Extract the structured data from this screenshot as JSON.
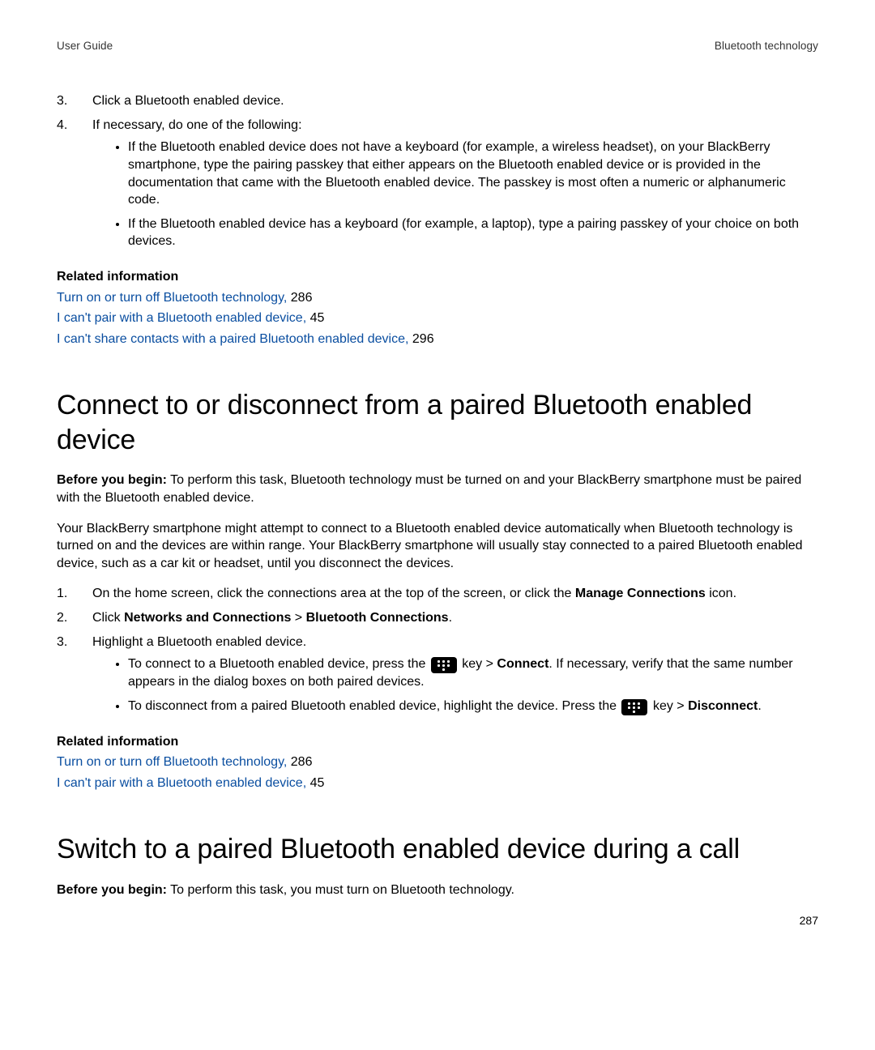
{
  "header": {
    "left": "User Guide",
    "right": "Bluetooth technology"
  },
  "pageNumber": "287",
  "top": {
    "steps": [
      "Click a Bluetooth enabled device.",
      "If necessary, do one of the following:"
    ],
    "bullets": [
      "If the Bluetooth enabled device does not have a keyboard (for example, a wireless headset), on your BlackBerry smartphone, type the pairing passkey that either appears on the Bluetooth enabled device or is provided in the documentation that came with the Bluetooth enabled device. The passkey is most often a numeric or alphanumeric code.",
      "If the Bluetooth enabled device has a keyboard (for example, a laptop), type a pairing passkey of your choice on both devices."
    ],
    "related": {
      "heading": "Related information",
      "items": [
        {
          "text": "Turn on or turn off Bluetooth technology,",
          "page": "286"
        },
        {
          "text": "I can't pair with a Bluetooth enabled device,",
          "page": "45"
        },
        {
          "text": "I can't share contacts with a paired Bluetooth enabled device,",
          "page": "296"
        }
      ]
    }
  },
  "section1": {
    "title": "Connect to or disconnect from a paired Bluetooth enabled device",
    "beforeLabel": "Before you begin:",
    "beforeText": " To perform this task, Bluetooth technology must be turned on and your BlackBerry smartphone must be paired with the Bluetooth enabled device.",
    "para": "Your BlackBerry smartphone might attempt to connect to a Bluetooth enabled device automatically when Bluetooth technology is turned on and the devices are within range. Your BlackBerry smartphone will usually stay connected to a paired Bluetooth enabled device, such as a car kit or headset, until you disconnect the devices.",
    "step1_pre": "On the home screen, click the connections area at the top of the screen, or click the ",
    "step1_bold": "Manage Connections",
    "step1_post": " icon.",
    "step2_pre": "Click ",
    "step2_b1": "Networks and Connections",
    "step2_gt": " > ",
    "step2_b2": "Bluetooth Connections",
    "step2_post": ".",
    "step3": "Highlight a Bluetooth enabled device.",
    "bullet1_pre": "To connect to a Bluetooth enabled device, press the ",
    "bullet1_mid": " key > ",
    "bullet1_bold": "Connect",
    "bullet1_post": ". If necessary, verify that the same number appears in the dialog boxes on both paired devices.",
    "bullet2_pre": "To disconnect from a paired Bluetooth enabled device, highlight the device. Press the ",
    "bullet2_mid": " key > ",
    "bullet2_bold": "Disconnect",
    "bullet2_post": ".",
    "related": {
      "heading": "Related information",
      "items": [
        {
          "text": "Turn on or turn off Bluetooth technology,",
          "page": "286"
        },
        {
          "text": "I can't pair with a Bluetooth enabled device,",
          "page": "45"
        }
      ]
    }
  },
  "section2": {
    "title": "Switch to a paired Bluetooth enabled device during a call",
    "beforeLabel": "Before you begin:",
    "beforeText": " To perform this task, you must turn on Bluetooth technology."
  }
}
